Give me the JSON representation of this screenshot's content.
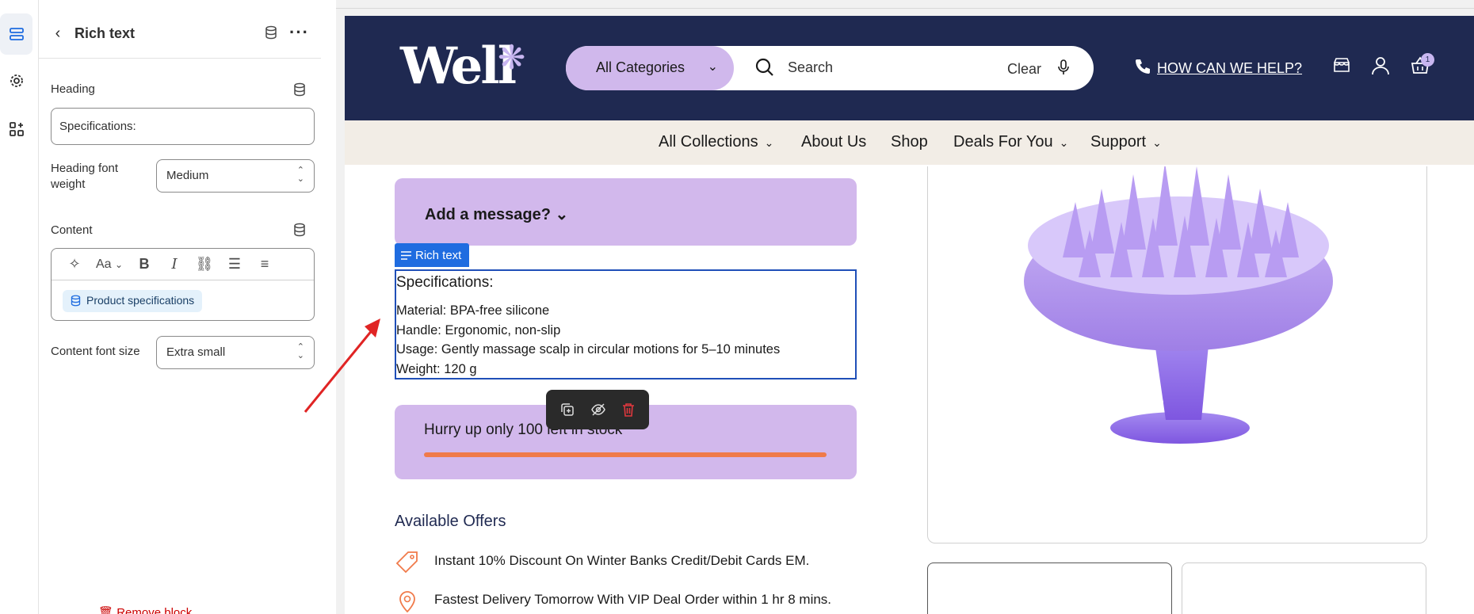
{
  "rail": {
    "items": [
      {
        "icon": "sections-icon",
        "active": true
      },
      {
        "icon": "settings-gear-icon",
        "active": false
      },
      {
        "icon": "apps-icon",
        "active": false
      }
    ]
  },
  "panel": {
    "title": "Rich text",
    "heading_label": "Heading",
    "heading_value": "Specifications:",
    "heading_font_weight_label": "Heading font weight",
    "heading_font_weight_value": "Medium",
    "content_label": "Content",
    "content_chip": "Product specifications",
    "content_font_size_label": "Content font size",
    "content_font_size_value": "Extra small",
    "remove_block": "Remove block"
  },
  "store": {
    "logo": "Well",
    "search": {
      "category": "All Categories",
      "placeholder": "Search",
      "clear": "Clear"
    },
    "help_link": "HOW CAN WE HELP?",
    "cart_count": "1",
    "nav": [
      {
        "label": "All Collections",
        "has_dropdown": true
      },
      {
        "label": "About Us",
        "has_dropdown": false
      },
      {
        "label": "Shop",
        "has_dropdown": false
      },
      {
        "label": "Deals For You",
        "has_dropdown": true
      },
      {
        "label": "Support",
        "has_dropdown": true
      }
    ],
    "message_box": "Add a message?",
    "rich_text_tag": "Rich text",
    "rich_text": {
      "heading": "Specifications:",
      "lines": [
        "Material: BPA-free silicone",
        "Handle: Ergonomic, non-slip",
        "Usage: Gently massage scalp in circular motions for 5–10 minutes",
        "Weight: 120 g"
      ]
    },
    "stock_text": "Hurry up only 100 left in stock",
    "offers_title": "Available Offers",
    "offers": [
      {
        "icon": "tag-icon",
        "text": "Instant 10% Discount On Winter Banks Credit/Debit Cards EM."
      },
      {
        "icon": "location-pin-icon",
        "text": "Fastest Delivery Tomorrow With VIP Deal Order within 1 hr 8 mins."
      }
    ],
    "colors": {
      "header_bg": "#1f2951",
      "accent_lavender": "#d2b8ec",
      "nav_bg": "#f2ede6",
      "stock_bar": "#f07a4a",
      "selection_blue": "#1f6ce0"
    }
  }
}
